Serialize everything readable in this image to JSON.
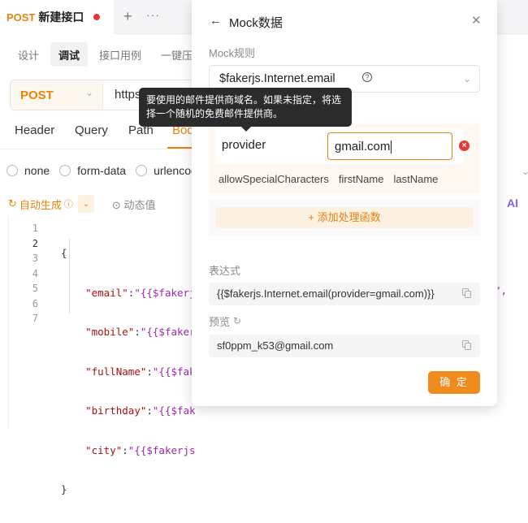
{
  "tab": {
    "method": "POST",
    "title": "新建接口",
    "plus": "+",
    "more": "···"
  },
  "subtabs": [
    "设计",
    "调试",
    "接口用例",
    "一键压测"
  ],
  "request": {
    "method": "POST",
    "url": "https://"
  },
  "req_tabs": [
    "Header",
    "Query",
    "Path",
    "Body"
  ],
  "body_types": [
    "none",
    "form-data",
    "urlencoded"
  ],
  "toolbar": {
    "auto_generate": "自动生成",
    "dynamic": "动态值",
    "ai": "AI"
  },
  "editor": {
    "line_numbers": [
      "1",
      "2",
      "3",
      "4",
      "5",
      "6",
      "7"
    ],
    "open_brace": "{",
    "close_brace": "}",
    "lines": [
      {
        "key": "\"email\"",
        "val": "\"{{$fakerj"
      },
      {
        "key": "\"mobile\"",
        "val": "\"{{$faker"
      },
      {
        "key": "\"fullName\"",
        "val": "\"{{$fak"
      },
      {
        "key": "\"birthday\"",
        "val": "\"{{$fak"
      },
      {
        "key": "\"city\"",
        "val": "\"{{$fakerjs"
      }
    ],
    "tail": "}}\","
  },
  "tooltip": {
    "text": "要使用的邮件提供商域名。如果未指定，将选择一个随机的免费邮件提供商。"
  },
  "panel": {
    "title": "Mock数据",
    "rule_label": "Mock规则",
    "rule_value": "$fakerjs.Internet.email",
    "param_key": "provider",
    "param_value": "gmail.com",
    "chips": [
      "allowSpecialCharacters",
      "firstName",
      "lastName"
    ],
    "add_fn": "+  添加处理函数",
    "expr_label": "表达式",
    "expr_value": "{{$fakerjs.Internet.email(provider=gmail.com)}}",
    "preview_label": "预览",
    "preview_value": "sf0ppm_k53@gmail.com",
    "confirm": "确 定"
  }
}
